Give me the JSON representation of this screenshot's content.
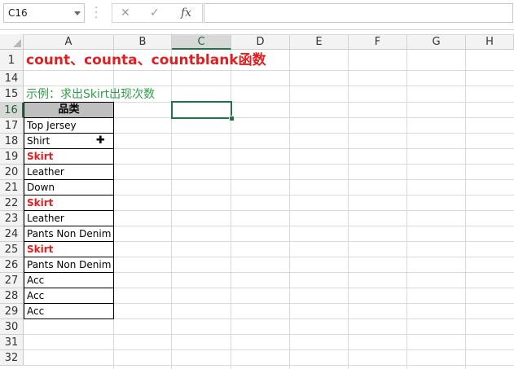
{
  "formula_bar": {
    "name_box": "C16",
    "cancel_glyph": "✕",
    "enter_glyph": "✓",
    "fx_label": "fx",
    "formula": ""
  },
  "columns": [
    "A",
    "B",
    "C",
    "D",
    "E",
    "F",
    "G",
    "H"
  ],
  "rows": [
    "1",
    "14",
    "15",
    "16",
    "17",
    "18",
    "19",
    "20",
    "21",
    "22",
    "23",
    "24",
    "25",
    "26",
    "27",
    "28",
    "29",
    "30",
    "31",
    "32"
  ],
  "cells": {
    "title": "count、counta、countblank函数",
    "example": "示例：求出Skirt出现次数",
    "header": "品类",
    "items": [
      {
        "text": "Top Jersey",
        "highlight": false
      },
      {
        "text": "Shirt",
        "highlight": false
      },
      {
        "text": "Skirt",
        "highlight": true
      },
      {
        "text": "Leather",
        "highlight": false
      },
      {
        "text": "Down",
        "highlight": false
      },
      {
        "text": "Skirt",
        "highlight": true
      },
      {
        "text": "Leather",
        "highlight": false
      },
      {
        "text": "Pants Non Denim",
        "highlight": false
      },
      {
        "text": "Skirt",
        "highlight": true
      },
      {
        "text": "Pants Non Denim",
        "highlight": false
      },
      {
        "text": "Acc",
        "highlight": false
      },
      {
        "text": "Acc",
        "highlight": false
      },
      {
        "text": "Acc",
        "highlight": false
      }
    ]
  },
  "selected_cell": "C16",
  "colors": {
    "accent": "#217346",
    "title": "#e02020",
    "example": "#2e9e46",
    "header_fill": "#bfbfbf"
  }
}
